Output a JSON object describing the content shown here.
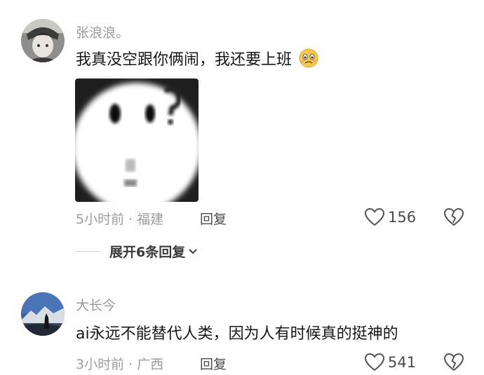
{
  "comments": [
    {
      "username": "张浪浪。",
      "text": "我真没空跟你俩闹，我还要上班",
      "emoji_icon": "frowning-face-emoji",
      "has_image": true,
      "time": "5小时前",
      "location": "福建",
      "reply_label": "回复",
      "likes": "156"
    },
    {
      "username": "大长今",
      "text": "ai永远不能替代人类，因为人有时候真的挺神的",
      "time": "3小时前",
      "location": "广西",
      "reply_label": "回复",
      "likes": "541"
    }
  ],
  "expand_replies": "展开6条回复",
  "meta_separator": "·"
}
